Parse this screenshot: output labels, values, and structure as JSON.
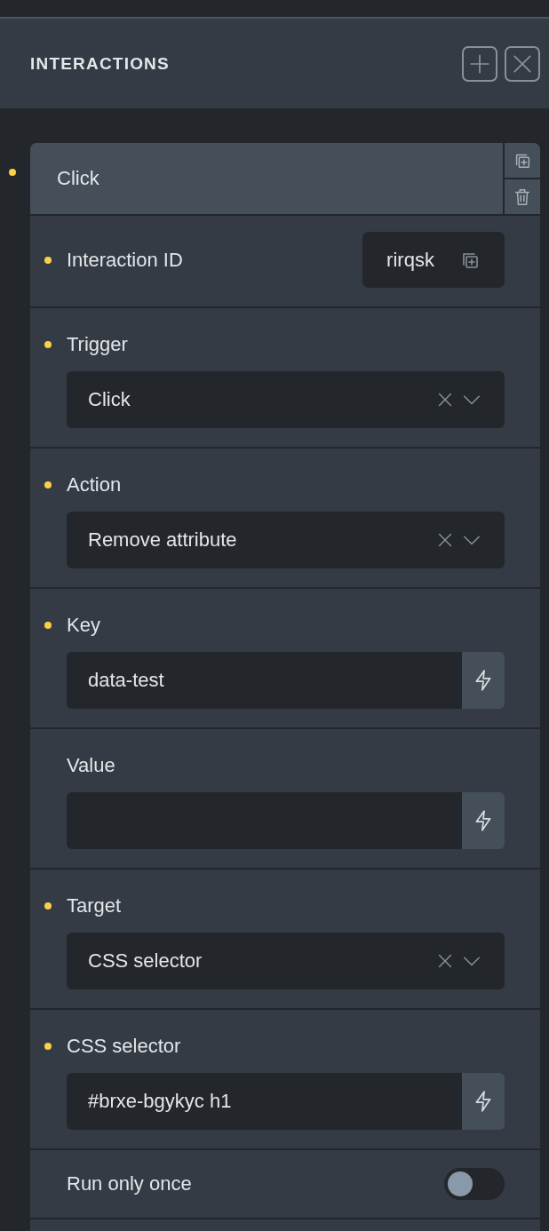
{
  "panel": {
    "title": "INTERACTIONS"
  },
  "interaction": {
    "title": "Click",
    "marked": true,
    "fields": [
      {
        "kind": "id",
        "label": "Interaction ID",
        "marked": true,
        "value": "rirqsk"
      },
      {
        "kind": "select",
        "label": "Trigger",
        "marked": true,
        "value": "Click"
      },
      {
        "kind": "select",
        "label": "Action",
        "marked": true,
        "value": "Remove attribute"
      },
      {
        "kind": "input",
        "label": "Key",
        "marked": true,
        "value": "data-test"
      },
      {
        "kind": "input",
        "label": "Value",
        "marked": false
      },
      {
        "kind": "select",
        "label": "Target",
        "marked": true,
        "value": "CSS selector"
      },
      {
        "kind": "input",
        "label": "CSS selector",
        "marked": true,
        "value": "#brxe-bgykyc h1"
      },
      {
        "kind": "toggle",
        "label": "Run only once",
        "marked": false,
        "on": false
      }
    ]
  }
}
